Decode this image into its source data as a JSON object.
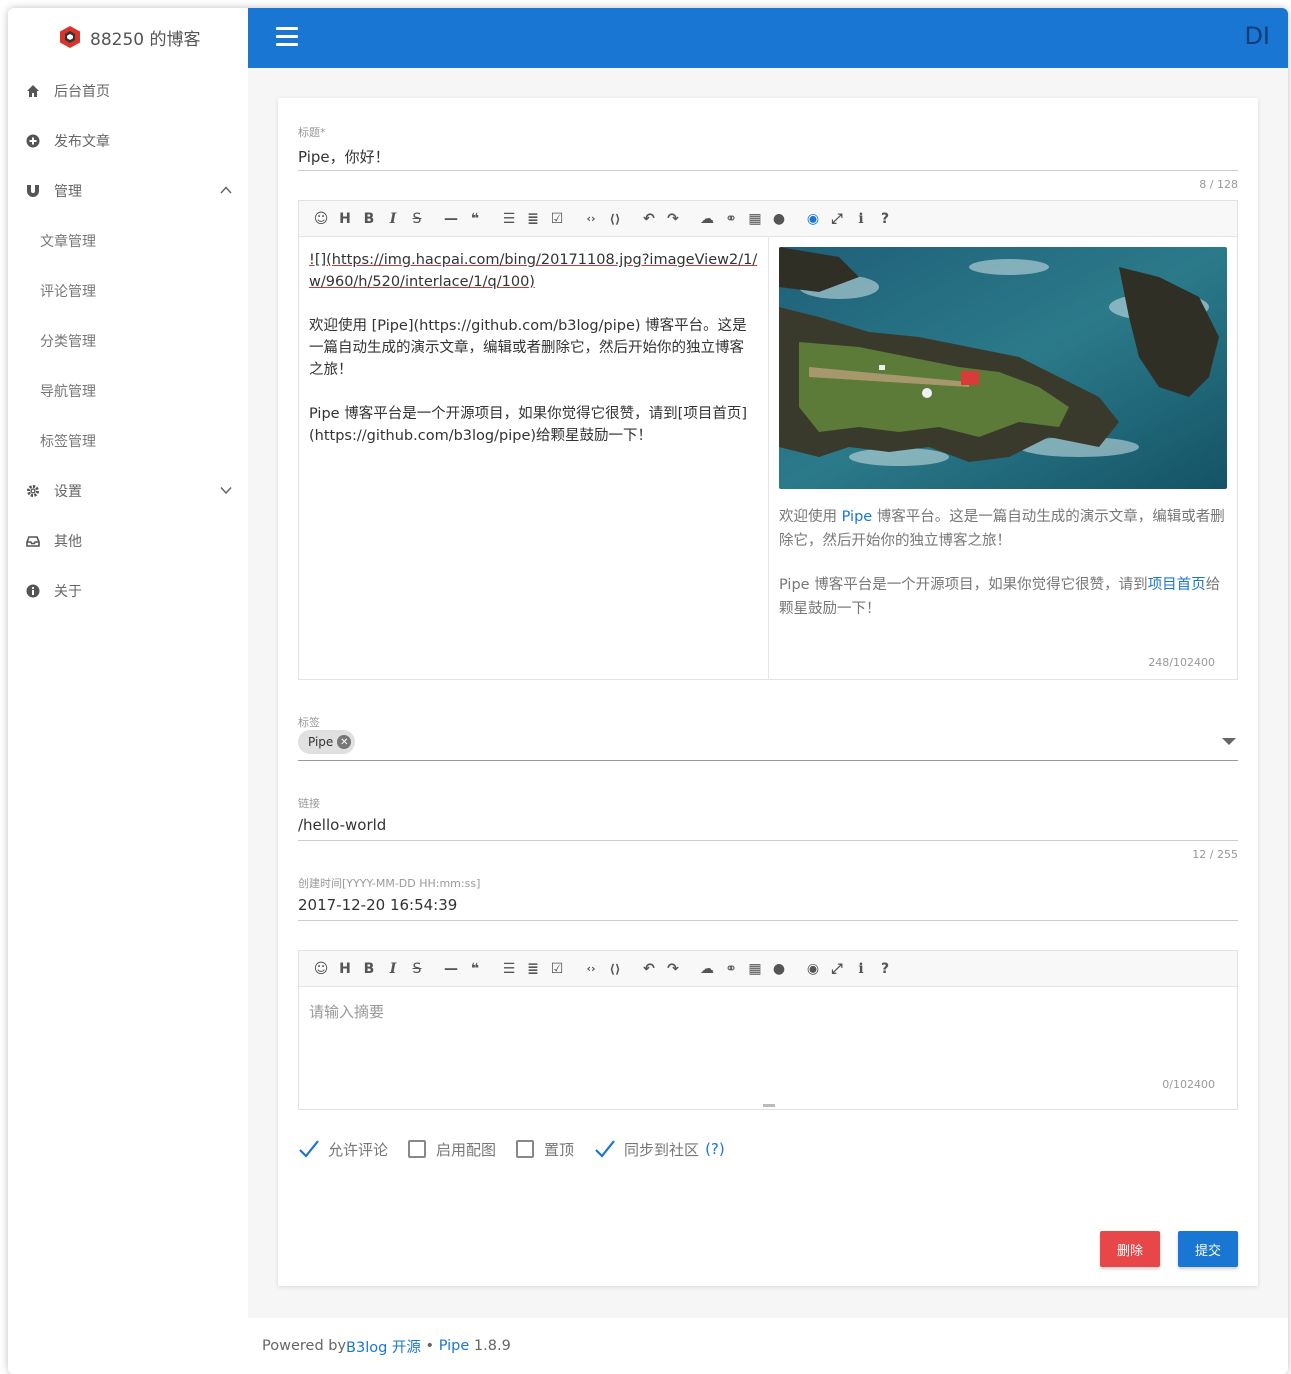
{
  "brand": {
    "name": "88250 的博客"
  },
  "sidebar": {
    "items": [
      {
        "label": "后台首页",
        "icon": "home-icon"
      },
      {
        "label": "发布文章",
        "icon": "plus-circle-icon"
      },
      {
        "label": "管理",
        "icon": "magnet-icon"
      },
      {
        "label": "设置",
        "icon": "gear-icon"
      },
      {
        "label": "其他",
        "icon": "inbox-icon"
      },
      {
        "label": "关于",
        "icon": "info-icon"
      }
    ],
    "sub_items": [
      "文章管理",
      "评论管理",
      "分类管理",
      "导航管理",
      "标签管理"
    ]
  },
  "topbar": {
    "avatar_text": "DI",
    "color": "#1976d2"
  },
  "form": {
    "title_label": "标题*",
    "title_value": "Pipe，你好！",
    "title_counter": "8 / 128",
    "content_source": {
      "line1": "![](https://img.hacpai.com/bing/20171108.jpg?imageView2/1/w/960/h/520/interlace/1/q/100)",
      "para2": "欢迎使用 [Pipe](https://github.com/b3log/pipe) 博客平台。这是一篇自动生成的演示文章，编辑或者删除它，然后开始你的独立博客之旅！",
      "para3": "Pipe 博客平台是一个开源项目，如果你觉得它很赞，请到[项目首页](https://github.com/b3log/pipe)给颗星鼓励一下！"
    },
    "preview": {
      "p1_a": "欢迎使用 ",
      "p1_link": "Pipe",
      "p1_b": " 博客平台。这是一篇自动生成的演示文章，编辑或者删除它，然后开始你的独立博客之旅！",
      "p2_a": "Pipe 博客平台是一个开源项目，如果你觉得它很赞，请到",
      "p2_link": "项目首页",
      "p2_b": "给颗星鼓励一下！"
    },
    "content_counter": "248/102400",
    "tags_label": "标签",
    "tag_chip": "Pipe",
    "link_label": "链接",
    "link_value": "/hello-world",
    "link_counter": "12 / 255",
    "created_label": "创建时间[YYYY-MM-DD HH:mm:ss]",
    "created_value": "2017-12-20 16:54:39",
    "abstract_placeholder": "请输入摘要",
    "abstract_counter": "0/102400"
  },
  "options": {
    "allow_comment": "允许评论",
    "enable_cover": "启用配图",
    "pin_top": "置顶",
    "sync_community": "同步到社区",
    "help": "(?)"
  },
  "buttons": {
    "delete": "删除",
    "submit": "提交",
    "delete_color": "#e8474a",
    "submit_color": "#1976d2"
  },
  "footer": {
    "powered_by": "Powered by ",
    "b3log": "B3log 开源",
    "sep": " • ",
    "pipe": "Pipe",
    "version": " 1.8.9"
  }
}
